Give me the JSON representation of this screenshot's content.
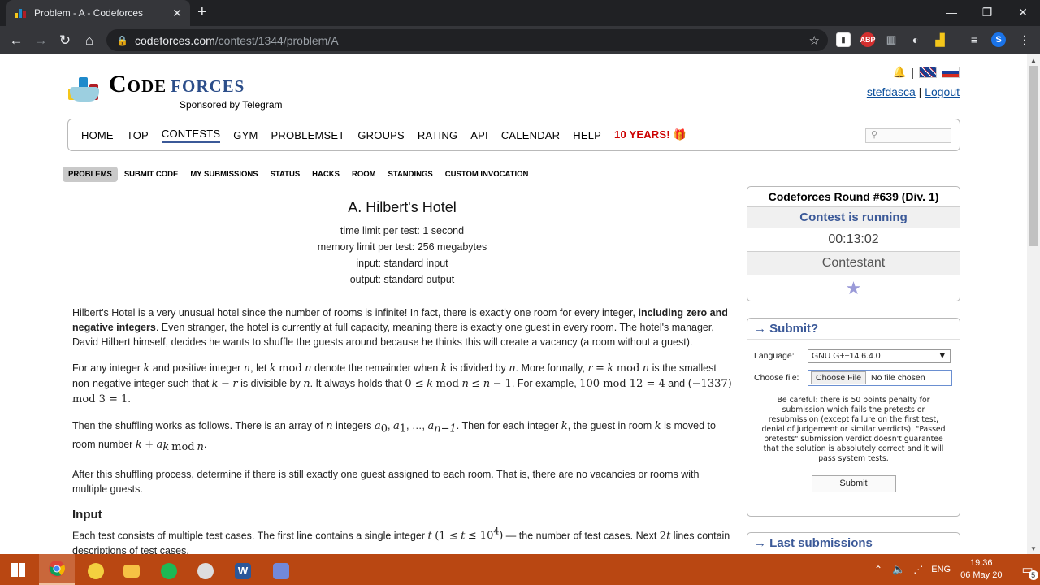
{
  "browser": {
    "tab_title": "Problem - A - Codeforces",
    "tab_close": "✕",
    "newtab": "+",
    "url_host": "codeforces.com",
    "url_path": "/contest/1344/problem/A",
    "ext_abp": "ABP",
    "profile_initial": "S",
    "win_min": "—",
    "win_max": "❐",
    "win_close": "✕"
  },
  "header": {
    "logo_word1": "Code",
    "logo_word2": "forces",
    "sponsor": "Sponsored by Telegram",
    "user": "stefdasca",
    "sep": "|",
    "logout": "Logout"
  },
  "menu": {
    "items": [
      "HOME",
      "TOP",
      "CONTESTS",
      "GYM",
      "PROBLEMSET",
      "GROUPS",
      "RATING",
      "API",
      "CALENDAR",
      "HELP",
      "10 YEARS! 🎁"
    ],
    "active": "CONTESTS"
  },
  "submenu": {
    "items": [
      "PROBLEMS",
      "SUBMIT CODE",
      "MY SUBMISSIONS",
      "STATUS",
      "HACKS",
      "ROOM",
      "STANDINGS",
      "CUSTOM INVOCATION"
    ]
  },
  "problem": {
    "title": "A. Hilbert's Hotel",
    "time_limit": "time limit per test: 1 second",
    "memory_limit": "memory limit per test: 256 megabytes",
    "input": "input: standard input",
    "output": "output: standard output",
    "p1_a": "Hilbert's Hotel is a very unusual hotel since the number of rooms is infinite! In fact, there is exactly one room for every integer, ",
    "p1_b": "including zero and negative integers",
    "p1_c": ". Even stranger, the hotel is currently at full capacity, meaning there is exactly one guest in every room. The hotel's manager, David Hilbert himself, decides he wants to shuffle the guests around because he thinks this will create a vacancy (a room without a guest).",
    "p4": "After this shuffling process, determine if there is still exactly one guest assigned to each room. That is, there are no vacancies or rooms with multiple guests.",
    "input_heading": "Input"
  },
  "sidebar": {
    "round_title": "Codeforces Round #639 (Div. 1)",
    "status": "Contest is running",
    "timer": "00:13:02",
    "role": "Contestant",
    "submit_caption": "→ Submit?",
    "language_label": "Language:",
    "language_value": "GNU G++14 6.4.0",
    "file_label": "Choose file:",
    "file_button": "Choose File",
    "file_status": "No file chosen",
    "warning": "Be careful: there is 50 points penalty for submission which fails the pretests or resubmission (except failure on the first test, denial of judgement or similar verdicts). \"Passed pretests\" submission verdict doesn't guarantee that the solution is absolutely correct and it will pass system tests.",
    "submit_button": "Submit",
    "last_caption": "→ Last submissions"
  },
  "taskbar": {
    "lang": "ENG",
    "time": "19:36",
    "date": "06 May 20",
    "notif_count": "5"
  }
}
